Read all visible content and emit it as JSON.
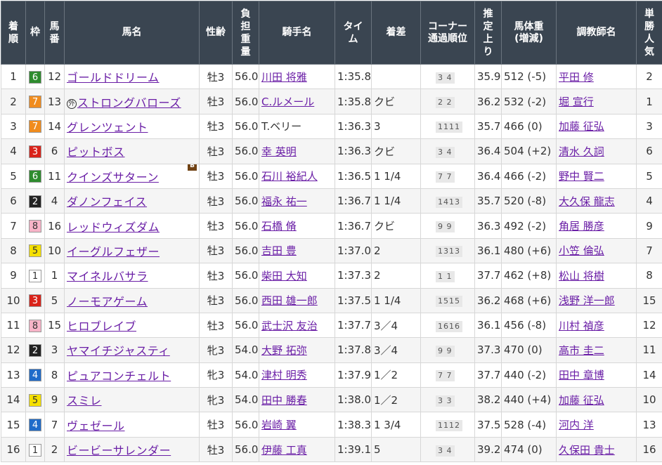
{
  "headers": {
    "rank": "着順",
    "waku": "枠",
    "umaban": "馬番",
    "horse": "馬名",
    "sexage": "性齢",
    "weight": "負担重量",
    "jockey": "騎手名",
    "time": "タイム",
    "margin": "着差",
    "corner_1": "コーナー",
    "corner_2": "通過順位",
    "agari": "推定上り",
    "body_1": "馬体重",
    "body_2": "(増減)",
    "trainer": "調教師名",
    "pop": "単勝人気"
  },
  "waku_colors": {
    "1": {
      "bg": "#ffffff",
      "fg": "#333333"
    },
    "2": {
      "bg": "#222222",
      "fg": "#ffffff"
    },
    "3": {
      "bg": "#d9231a",
      "fg": "#ffffff"
    },
    "4": {
      "bg": "#1f6bc9",
      "fg": "#ffffff"
    },
    "5": {
      "bg": "#f5e000",
      "fg": "#333333"
    },
    "6": {
      "bg": "#2e8b2e",
      "fg": "#ffffff"
    },
    "7": {
      "bg": "#f08c1e",
      "fg": "#ffffff"
    },
    "8": {
      "bg": "#f7b4c8",
      "fg": "#333333"
    }
  },
  "rows": [
    {
      "rank": "1",
      "waku": "6",
      "umaban": "12",
      "horse": "ゴールドドリーム",
      "prefix": "",
      "blinker": "",
      "sexage": "牡3",
      "weight": "56.0",
      "jockey": "川田 将雅",
      "jockey_link": true,
      "time": "1:35.8",
      "margin": "",
      "pass": "3 4",
      "agari": "35.9",
      "body": "512 (-5)",
      "trainer": "平田 修",
      "pop": "2"
    },
    {
      "rank": "2",
      "waku": "7",
      "umaban": "13",
      "horse": "ストロングバローズ",
      "prefix": "外",
      "blinker": "",
      "sexage": "牡3",
      "weight": "56.0",
      "jockey": "C.ルメール",
      "jockey_link": true,
      "time": "1:35.8",
      "margin": "クビ",
      "pass": "2 2",
      "agari": "36.2",
      "body": "532 (-2)",
      "trainer": "堀 宣行",
      "pop": "1"
    },
    {
      "rank": "3",
      "waku": "7",
      "umaban": "14",
      "horse": "グレンツェント",
      "prefix": "",
      "blinker": "",
      "sexage": "牡3",
      "weight": "56.0",
      "jockey": "T.ベリー",
      "jockey_link": false,
      "time": "1:36.3",
      "margin": "3",
      "pass": "1111",
      "agari": "35.7",
      "body": "466 (0)",
      "trainer": "加藤 征弘",
      "pop": "3"
    },
    {
      "rank": "4",
      "waku": "3",
      "umaban": "6",
      "horse": "ピットボス",
      "prefix": "",
      "blinker": "",
      "sexage": "牡3",
      "weight": "56.0",
      "jockey": "幸 英明",
      "jockey_link": true,
      "time": "1:36.3",
      "margin": "クビ",
      "pass": "3 4",
      "agari": "36.4",
      "body": "504 (+2)",
      "trainer": "清水 久詞",
      "pop": "6"
    },
    {
      "rank": "5",
      "waku": "6",
      "umaban": "11",
      "horse": "クインズサターン",
      "prefix": "",
      "blinker": "B",
      "sexage": "牡3",
      "weight": "56.0",
      "jockey": "石川 裕紀人",
      "jockey_link": true,
      "time": "1:36.5",
      "margin": "1 1/4",
      "pass": "7 7",
      "agari": "36.4",
      "body": "466 (-2)",
      "trainer": "野中 賢二",
      "pop": "5"
    },
    {
      "rank": "6",
      "waku": "2",
      "umaban": "4",
      "horse": "ダノンフェイス",
      "prefix": "",
      "blinker": "",
      "sexage": "牡3",
      "weight": "56.0",
      "jockey": "福永 祐一",
      "jockey_link": true,
      "time": "1:36.7",
      "margin": "1 1/4",
      "pass": "1413",
      "agari": "35.7",
      "body": "520 (-8)",
      "trainer": "大久保 龍志",
      "pop": "4"
    },
    {
      "rank": "7",
      "waku": "8",
      "umaban": "16",
      "horse": "レッドウィズダム",
      "prefix": "",
      "blinker": "",
      "sexage": "牡3",
      "weight": "56.0",
      "jockey": "石橋 脩",
      "jockey_link": true,
      "time": "1:36.7",
      "margin": "クビ",
      "pass": "9 9",
      "agari": "36.3",
      "body": "492 (-2)",
      "trainer": "角居 勝彦",
      "pop": "9"
    },
    {
      "rank": "8",
      "waku": "5",
      "umaban": "10",
      "horse": "イーグルフェザー",
      "prefix": "",
      "blinker": "",
      "sexage": "牡3",
      "weight": "56.0",
      "jockey": "吉田 豊",
      "jockey_link": true,
      "time": "1:37.0",
      "margin": "2",
      "pass": "1313",
      "agari": "36.1",
      "body": "480 (+6)",
      "trainer": "小笠 倫弘",
      "pop": "7"
    },
    {
      "rank": "9",
      "waku": "1",
      "umaban": "1",
      "horse": "マイネルバサラ",
      "prefix": "",
      "blinker": "",
      "sexage": "牡3",
      "weight": "56.0",
      "jockey": "柴田 大知",
      "jockey_link": true,
      "time": "1:37.3",
      "margin": "2",
      "pass": "1 1",
      "agari": "37.7",
      "body": "462 (+8)",
      "trainer": "松山 将樹",
      "pop": "8"
    },
    {
      "rank": "10",
      "waku": "3",
      "umaban": "5",
      "horse": "ノーモアゲーム",
      "prefix": "",
      "blinker": "",
      "sexage": "牡3",
      "weight": "56.0",
      "jockey": "西田 雄一郎",
      "jockey_link": true,
      "time": "1:37.5",
      "margin": "1 1/4",
      "pass": "1515",
      "agari": "36.2",
      "body": "468 (+6)",
      "trainer": "浅野 洋一郎",
      "pop": "15"
    },
    {
      "rank": "11",
      "waku": "8",
      "umaban": "15",
      "horse": "ヒロブレイブ",
      "prefix": "",
      "blinker": "",
      "sexage": "牡3",
      "weight": "56.0",
      "jockey": "武士沢 友治",
      "jockey_link": true,
      "time": "1:37.7",
      "margin": "3／4",
      "pass": "1616",
      "agari": "36.1",
      "body": "456 (-8)",
      "trainer": "川村 禎彦",
      "pop": "12"
    },
    {
      "rank": "12",
      "waku": "2",
      "umaban": "3",
      "horse": "ヤマイチジャスティ",
      "prefix": "",
      "blinker": "",
      "sexage": "牝3",
      "weight": "54.0",
      "jockey": "大野 拓弥",
      "jockey_link": true,
      "time": "1:37.8",
      "margin": "3／4",
      "pass": "9 9",
      "agari": "37.3",
      "body": "470 (0)",
      "trainer": "高市 圭二",
      "pop": "11"
    },
    {
      "rank": "13",
      "waku": "4",
      "umaban": "8",
      "horse": "ピュアコンチェルト",
      "prefix": "",
      "blinker": "",
      "sexage": "牝3",
      "weight": "54.0",
      "jockey": "津村 明秀",
      "jockey_link": true,
      "time": "1:37.9",
      "margin": "1／2",
      "pass": "7 7",
      "agari": "37.7",
      "body": "440 (-2)",
      "trainer": "田中 章博",
      "pop": "14"
    },
    {
      "rank": "14",
      "waku": "5",
      "umaban": "9",
      "horse": "スミレ",
      "prefix": "",
      "blinker": "",
      "sexage": "牝3",
      "weight": "54.0",
      "jockey": "田中 勝春",
      "jockey_link": true,
      "time": "1:38.0",
      "margin": "1／2",
      "pass": "3 3",
      "agari": "38.2",
      "body": "440 (+4)",
      "trainer": "加藤 征弘",
      "pop": "10"
    },
    {
      "rank": "15",
      "waku": "4",
      "umaban": "7",
      "horse": "ヴェゼール",
      "prefix": "",
      "blinker": "",
      "sexage": "牡3",
      "weight": "56.0",
      "jockey": "岩崎 翼",
      "jockey_link": true,
      "time": "1:38.3",
      "margin": "1 3/4",
      "pass": "1112",
      "agari": "37.5",
      "body": "528 (-4)",
      "trainer": "河内 洋",
      "pop": "13"
    },
    {
      "rank": "16",
      "waku": "1",
      "umaban": "2",
      "horse": "ビービーサレンダー",
      "prefix": "",
      "blinker": "",
      "sexage": "牡3",
      "weight": "56.0",
      "jockey": "伊藤 工真",
      "jockey_link": true,
      "time": "1:39.1",
      "margin": "5",
      "pass": "3 4",
      "agari": "39.2",
      "body": "474 (0)",
      "trainer": "久保田 貴士",
      "pop": "16"
    }
  ]
}
